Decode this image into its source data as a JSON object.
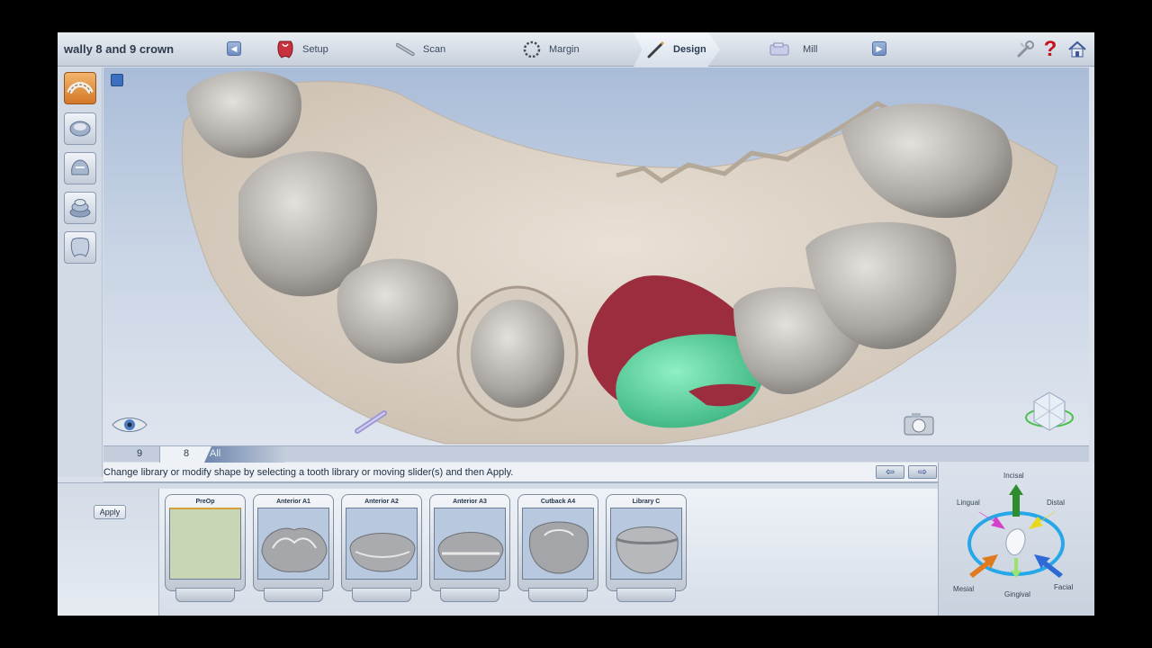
{
  "header": {
    "case_title": "wally 8 and 9 crown",
    "steps": [
      {
        "label": "Setup",
        "icon": "tooth-setup-icon",
        "active": false
      },
      {
        "label": "Scan",
        "icon": "scanner-wand-icon",
        "active": false
      },
      {
        "label": "Margin",
        "icon": "margin-ring-icon",
        "active": false
      },
      {
        "label": "Design",
        "icon": "design-pen-icon",
        "active": true
      },
      {
        "label": "Mill",
        "icon": "mill-block-icon",
        "active": false
      }
    ],
    "prev_glyph": "◀",
    "next_glyph": "▶",
    "utilities": [
      "tools-icon",
      "help-icon",
      "home-icon"
    ],
    "help_glyph": "?"
  },
  "left_tools": [
    "arch-view-icon",
    "prep-view-icon",
    "crown-view-icon",
    "stack-view-icon",
    "tooth-shape-icon"
  ],
  "tooth_tabs": [
    {
      "label": "9",
      "active": false
    },
    {
      "label": "8",
      "active": true
    },
    {
      "label": "All",
      "active": false
    }
  ],
  "instruction": "Change library or modify shape by selecting a tooth library or moving slider(s) and then Apply.",
  "undo_glyph": "⇦",
  "redo_glyph": "⇨",
  "apply_label": "Apply",
  "libraries": [
    {
      "title": "PreOp"
    },
    {
      "title": "Anterior A1"
    },
    {
      "title": "Anterior A2"
    },
    {
      "title": "Anterior A3"
    },
    {
      "title": "Cutback A4"
    },
    {
      "title": "Library C"
    }
  ],
  "orientation": {
    "incisal": "Incisal",
    "lingual": "Lingual",
    "distal": "Distal",
    "mesial": "Mesial",
    "gingival": "Gingival",
    "facial": "Facial",
    "colors": {
      "incisal": "#2e8b2e",
      "lingual": "#d63fc8",
      "distal": "#e8d81a",
      "mesial": "#e07a1e",
      "gingival": "#9be36a",
      "facial": "#2d6ad6",
      "ring": "#26a8e8"
    }
  },
  "model_colors": {
    "stone": "#e1d7ca",
    "tooth": "#c8c4c0",
    "crown_overlap": "#9b2d3f",
    "crown_contact": "#58d6a0"
  }
}
